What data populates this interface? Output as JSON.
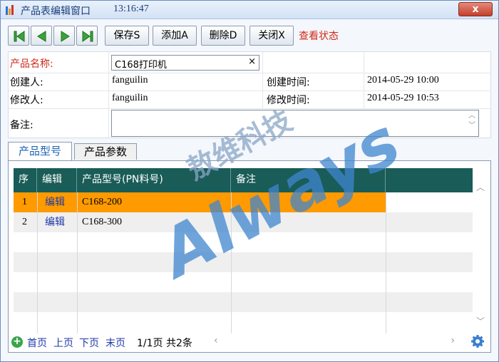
{
  "window": {
    "title": "产品表编辑窗口",
    "time": "13:16:47",
    "close_label": "x"
  },
  "toolbar": {
    "save_label": "保存S",
    "add_label": "添加A",
    "delete_label": "删除D",
    "close_label": "关闭X",
    "view_status_label": "查看状态"
  },
  "form": {
    "name_label": "产品名称:",
    "name_value": "C168打印机",
    "clear_glyph": "×",
    "creator_label": "创建人:",
    "creator_value": "fanguilin",
    "created_time_label": "创建时间:",
    "created_time_value": "2014-05-29 10:00",
    "modifier_label": "修改人:",
    "modifier_value": "fanguilin",
    "modified_time_label": "修改时间:",
    "modified_time_value": "2014-05-29 10:53",
    "remark_label": "备注:"
  },
  "tabs": [
    {
      "label": "产品型号",
      "active": true
    },
    {
      "label": "产品参数",
      "active": false
    }
  ],
  "grid": {
    "columns": [
      "序",
      "编辑",
      "产品型号(PN料号)",
      "备注"
    ],
    "rows": [
      {
        "seq": "1",
        "edit": "编辑",
        "model": "C168-200",
        "remark": ""
      },
      {
        "seq": "2",
        "edit": "编辑",
        "model": "C168-300",
        "remark": ""
      }
    ]
  },
  "pager": {
    "first": "首页",
    "prev": "上页",
    "next": "下页",
    "last": "末页",
    "page_info": "1/1页 共2条"
  },
  "watermark": {
    "cn": "敖维科技",
    "en": "Always"
  },
  "colors": {
    "header_bg": "#1a5c57",
    "selected_row": "#ff9a00",
    "link": "#1e3aa8",
    "label_red": "#d12a1c"
  }
}
